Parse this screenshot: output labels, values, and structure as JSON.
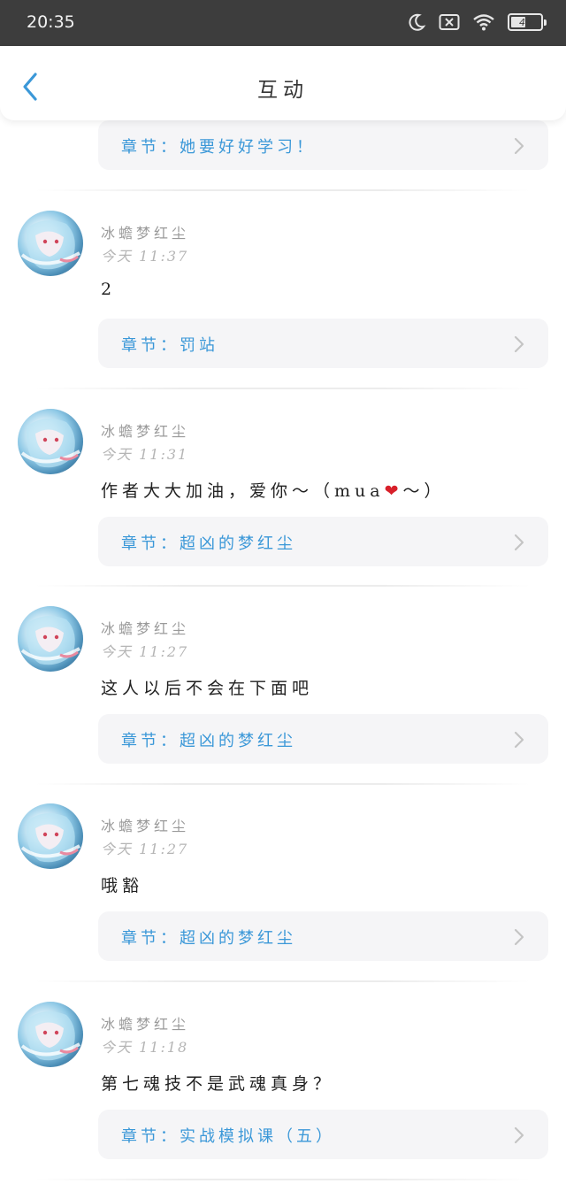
{
  "status_bar": {
    "time": "20:35",
    "battery": "49",
    "battery_level": 0.49,
    "icons": [
      "moon-icon",
      "notification-x-icon",
      "wifi-icon",
      "battery-icon"
    ]
  },
  "header": {
    "title": "互动",
    "back_icon": "chevron-left-icon"
  },
  "top_chapter": {
    "label": "章节：她要好好学习！"
  },
  "comments": [
    {
      "username": "冰蟾梦红尘",
      "time": "今天 11:37",
      "text": "2",
      "chapter": "章节：罚站"
    },
    {
      "username": "冰蟾梦红尘",
      "time": "今天 11:31",
      "text": "作者大大加油，爱你～（mua",
      "text_emoji": "❤",
      "text_tail": "～）",
      "chapter": "章节：超凶的梦红尘"
    },
    {
      "username": "冰蟾梦红尘",
      "time": "今天 11:27",
      "text": "这人以后不会在下面吧",
      "chapter": "章节：超凶的梦红尘"
    },
    {
      "username": "冰蟾梦红尘",
      "time": "今天 11:27",
      "text": "哦豁",
      "chapter": "章节：超凶的梦红尘"
    },
    {
      "username": "冰蟾梦红尘",
      "time": "今天 11:18",
      "text": "第七魂技不是武魂真身？",
      "chapter": "章节：实战模拟课（五）"
    }
  ],
  "colors": {
    "accent": "#3b98d8",
    "status_bar": "#3d3d3d",
    "chapter_bg": "#f5f5f7",
    "heart": "#d8202a"
  }
}
